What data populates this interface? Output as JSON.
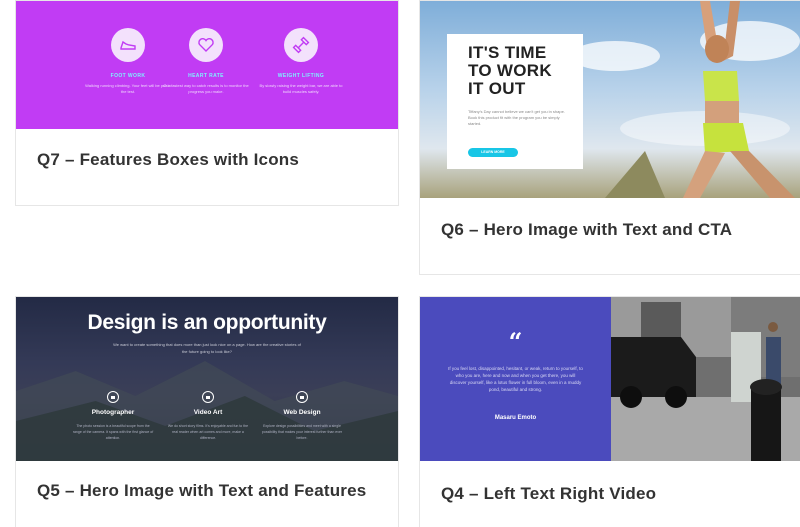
{
  "cards": [
    {
      "id": "q7",
      "title": "Q7 – Features Boxes with Icons",
      "features": [
        {
          "title": "FOOT WORK",
          "desc": "Walking running climbing. Your feet will be put to the test.",
          "icon": "shoe-icon"
        },
        {
          "title": "HEART RATE",
          "desc": "Our fastest way to catch results is to monitor the progress you make.",
          "icon": "heart-icon"
        },
        {
          "title": "WEIGHT LIFTING",
          "desc": "By slowly raising the weight bar, we are able to build muscles safely.",
          "icon": "dumbbell-icon"
        }
      ],
      "accent": "#c13cf4"
    },
    {
      "id": "q6",
      "title": "Q6 – Hero Image with Text and CTA",
      "heading": "IT'S TIME\nTO WORK\nIT OUT",
      "text": "Tiffany's Day cannot believe we can't get you in shape. Book this product fit with the program you be simply started.",
      "button": "LEARN MORE"
    },
    {
      "id": "q5",
      "title": "Q5 – Hero Image with Text and Features",
      "heading": "Design is an opportunity",
      "subtext": "We want to create something that does more than just look nice on a page. How are the creative stories of the future going to look like?",
      "features": [
        {
          "title": "Photographer",
          "desc": "The photo session is a beautiful scope from the range of the camera. It spans with the first glance of attention."
        },
        {
          "title": "Video Art",
          "desc": "We do short story films. It's enjoyable and fun to the real reader when art comes and more, make a difference."
        },
        {
          "title": "Web Design",
          "desc": "Explore design possibilities and meet with a single possibility that makes your interest further than ever before."
        }
      ]
    },
    {
      "id": "q4",
      "title": "Q4 – Left Text Right Video",
      "quote_mark": "“",
      "quote": "If you feel lost, disappointed, hesitant, or weak, return to yourself, to who you are, here and now and when you get there, you will discover yourself, like a lotus flower in full bloom, even in a muddy pond, beautiful and strong.",
      "author": "Masaru Emoto",
      "accent": "#4b4bbd"
    }
  ]
}
